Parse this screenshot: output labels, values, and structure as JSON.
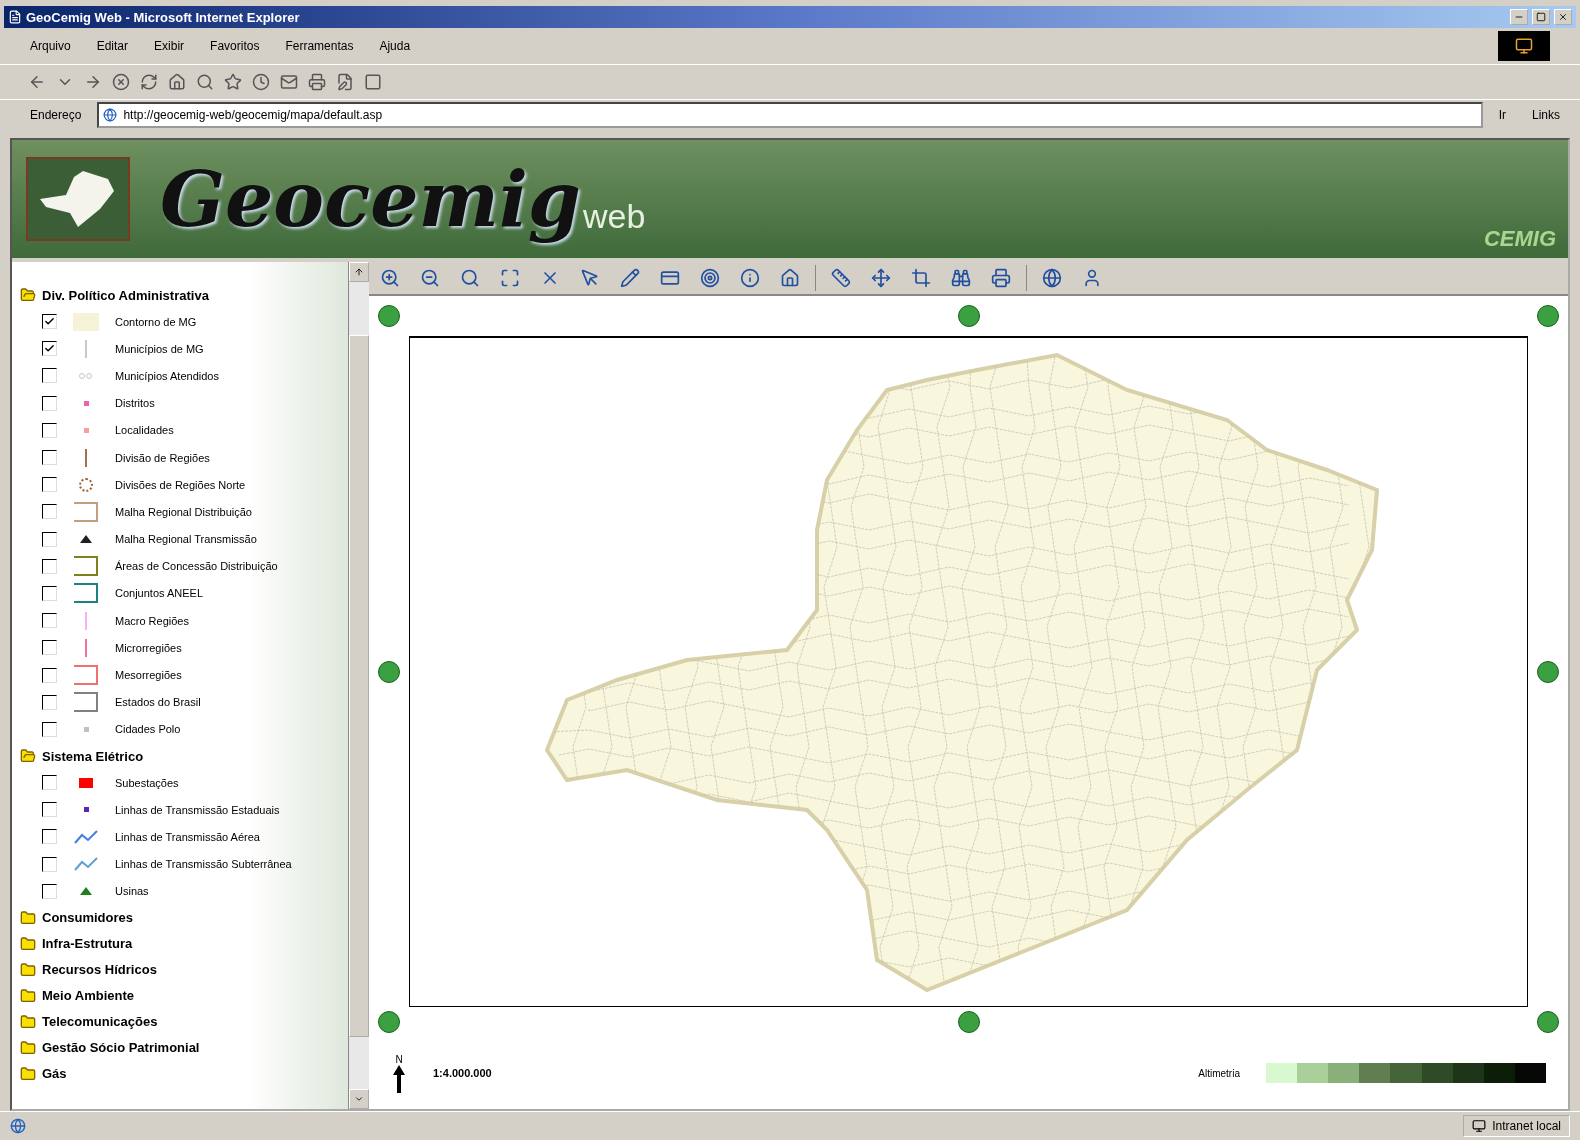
{
  "window": {
    "title": "GeoCemig Web - Microsoft Internet Explorer"
  },
  "menu": [
    "Arquivo",
    "Editar",
    "Exibir",
    "Favoritos",
    "Ferramentas",
    "Ajuda"
  ],
  "address": {
    "label": "Endereço",
    "url": "http://geocemig-web/geocemig/mapa/default.asp",
    "go": "Ir",
    "links": "Links"
  },
  "header": {
    "logo_main": "Geocemig",
    "logo_sub": "web",
    "brand": "CEMIG"
  },
  "layers": [
    {
      "label": "Div. Político Administrativa",
      "expanded": true,
      "children": [
        {
          "label": "Contorno de MG",
          "checked": true,
          "kind": "fill",
          "color": "#f5f2d8"
        },
        {
          "label": "Municípios de MG",
          "checked": true,
          "kind": "line",
          "color": "#c8c8c8"
        },
        {
          "label": "Municípios Atendidos",
          "checked": false,
          "kind": "dots",
          "color": "#c8c8c8"
        },
        {
          "label": "Distritos",
          "checked": false,
          "kind": "point",
          "color": "#f060b0"
        },
        {
          "label": "Localidades",
          "checked": false,
          "kind": "point",
          "color": "#f4a0a0"
        },
        {
          "label": "Divisão de Regiões",
          "checked": false,
          "kind": "line",
          "color": "#a07050"
        },
        {
          "label": "Divisões de Regiões Norte",
          "checked": false,
          "kind": "ring",
          "color": "#a06030"
        },
        {
          "label": "Malha Regional Distribuição",
          "checked": false,
          "kind": "outline",
          "color": "#c0a080"
        },
        {
          "label": "Malha Regional Transmissão",
          "checked": false,
          "kind": "marker",
          "color": "#202020"
        },
        {
          "label": "Áreas de Concessão Distribuição",
          "checked": false,
          "kind": "outline",
          "color": "#808020"
        },
        {
          "label": "Conjuntos ANEEL",
          "checked": false,
          "kind": "outline",
          "color": "#208080"
        },
        {
          "label": "Macro Regiões",
          "checked": false,
          "kind": "line",
          "color": "#f8b0f0"
        },
        {
          "label": "Microrregiões",
          "checked": false,
          "kind": "line",
          "color": "#f070a0"
        },
        {
          "label": "Mesorregiões",
          "checked": false,
          "kind": "outline",
          "color": "#f07070"
        },
        {
          "label": "Estados do Brasil",
          "checked": false,
          "kind": "outline",
          "color": "#808080"
        },
        {
          "label": "Cidades Polo",
          "checked": false,
          "kind": "point",
          "color": "#c0c0c0"
        }
      ]
    },
    {
      "label": "Sistema Elétrico",
      "expanded": true,
      "children": [
        {
          "label": "Subestações",
          "checked": false,
          "kind": "fill",
          "color": "#ff0000"
        },
        {
          "label": "Linhas de Transmissão Estaduais",
          "checked": false,
          "kind": "point",
          "color": "#6020c0"
        },
        {
          "label": "Linhas de Transmissão Aérea",
          "checked": false,
          "kind": "dash",
          "color": "#4080e0"
        },
        {
          "label": "Linhas de Transmissão Subterrânea",
          "checked": false,
          "kind": "dash",
          "color": "#60a0d0"
        },
        {
          "label": "Usinas",
          "checked": false,
          "kind": "marker",
          "color": "#208020"
        }
      ]
    },
    {
      "label": "Consumidores",
      "expanded": false
    },
    {
      "label": "Infra-Estrutura",
      "expanded": false
    },
    {
      "label": "Recursos Hídricos",
      "expanded": false
    },
    {
      "label": "Meio Ambiente",
      "expanded": false
    },
    {
      "label": "Telecomunicações",
      "expanded": false
    },
    {
      "label": "Gestão Sócio Patrimonial",
      "expanded": false
    },
    {
      "label": "Gás",
      "expanded": false
    }
  ],
  "map": {
    "north": "N",
    "scale": "1:4.000.000",
    "legend_label": "Altimetria"
  },
  "status_bar": {
    "zone": "Intranet local"
  }
}
